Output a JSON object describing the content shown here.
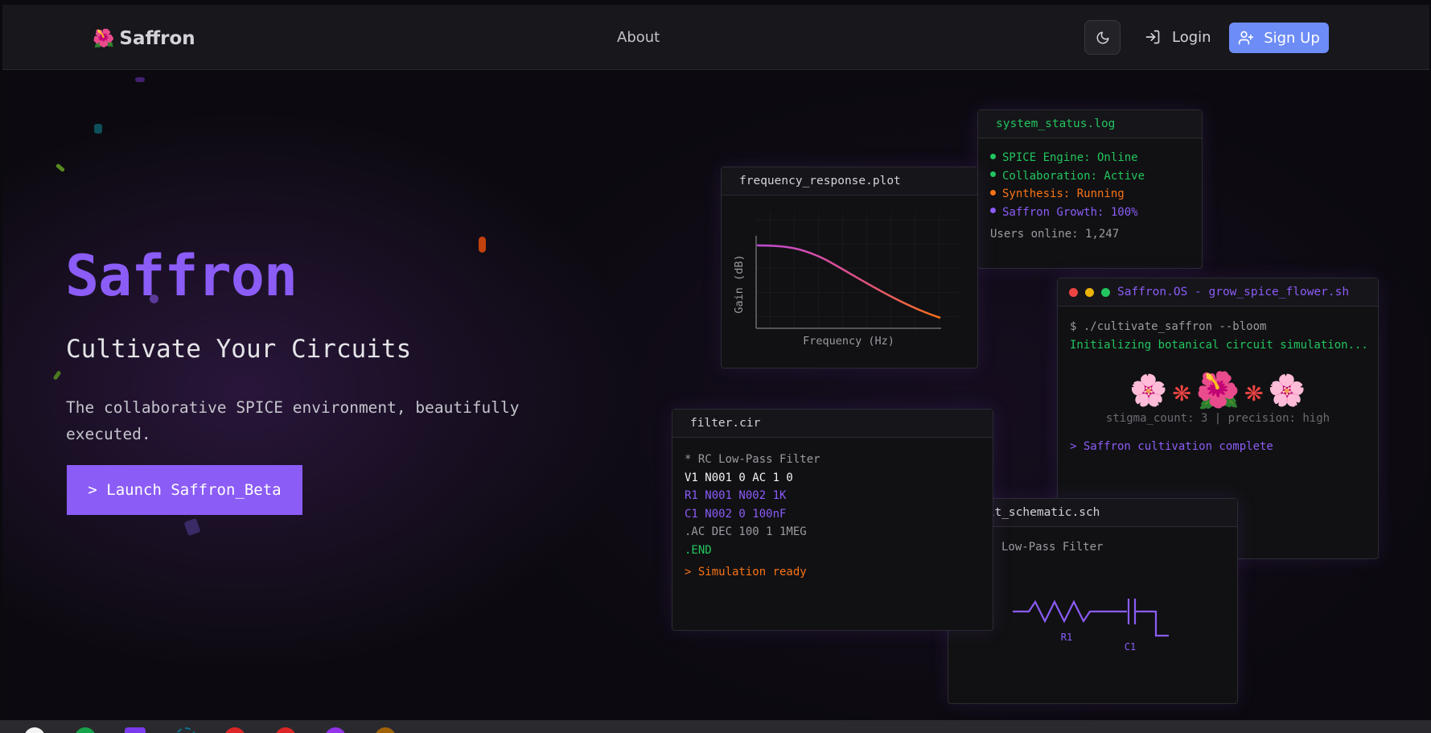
{
  "nav": {
    "brand_icon": "🌺",
    "brand": "Saffron",
    "about": "About",
    "login": "Login",
    "signup": "Sign Up",
    "accent": "#6d8cf6"
  },
  "hero": {
    "title": "Saffron",
    "subtitle": "Cultivate Your Circuits",
    "description": "The collaborative SPICE environment, beautifully executed.",
    "launch": "> Launch Saffron_Beta",
    "accent": "#8b5cf6"
  },
  "status_window": {
    "title": "system_status.log",
    "lines": [
      "SPICE Engine: Online",
      "Collaboration: Active",
      "Synthesis: Running",
      "Saffron Growth: 100%"
    ],
    "users": "Users online: 1,247"
  },
  "plot_window": {
    "title": "frequency_response.plot",
    "ylabel": "Gain (dB)",
    "xlabel": "Frequency (Hz)"
  },
  "terminal_window": {
    "title": "Saffron.OS - grow_spice_flower.sh",
    "command": "$ ./cultivate_saffron --bloom",
    "init": "Initializing botanical circuit simulation...",
    "flowers": [
      "🌸",
      "❋",
      "🌺",
      "❋",
      "🌸"
    ],
    "stats": "stigma_count: 3 | precision: high",
    "complete": "> Saffron cultivation complete"
  },
  "filter_window": {
    "title": "filter.cir",
    "lines": [
      "* RC Low-Pass Filter",
      "V1 N001 0 AC 1 0",
      "R1 N001 N002 1K",
      "C1 N002 0 100nF",
      ".AC DEC 100 1 1MEG",
      ".END"
    ],
    "ready": "> Simulation ready"
  },
  "schematic_window": {
    "title": "uit_schematic.sch",
    "subtitle": "Low-Pass Filter",
    "r_label": "R1",
    "c_label": "C1"
  }
}
